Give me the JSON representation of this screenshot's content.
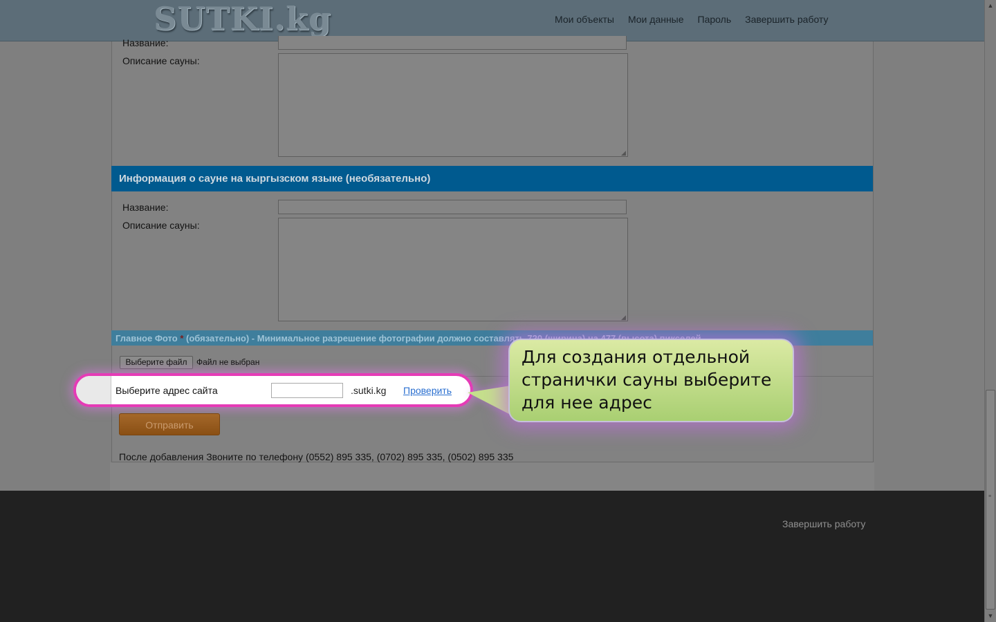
{
  "header": {
    "logo": "SUTKI.kg",
    "nav": [
      "Мои объекты",
      "Мои данные",
      "Пароль",
      "Завершить работу"
    ]
  },
  "form": {
    "ru_name_label": "Название:",
    "ru_desc_label": "Описание сауны:",
    "ky_section_title": "Информация о сауне на кыргызском языке (необязательно)",
    "ky_name_label": "Название:",
    "ky_desc_label": "Описание сауны:",
    "photo_title_a": "Главное Фото ",
    "photo_required_mark": "*",
    "photo_title_b": " (обязательно) - Минимальное разрешение фотографии должно составлять 720 (ширина) на 477 (высота) пикселей",
    "file_button": "Выберите файл",
    "file_status": "Файл не выбран",
    "site_label": "Выберите адрес сайта",
    "site_value": "",
    "site_domain": ".sutki.kg",
    "check_link": "Проверить",
    "submit": "Отправить",
    "after_text": "После добавления Звоните по телефону (0552) 895 335, (0702) 895 335, (0502) 895 335"
  },
  "tooltip": {
    "text": "Для создания отдельной странички сауны выберите для нее адрес"
  },
  "footer": {
    "logout": "Завершить работу"
  },
  "colors": {
    "section_blue": "#005a8f",
    "highlight_border": "#e53bb6",
    "bubble_green": "#c5df8c",
    "link": "#2a6fd0"
  }
}
